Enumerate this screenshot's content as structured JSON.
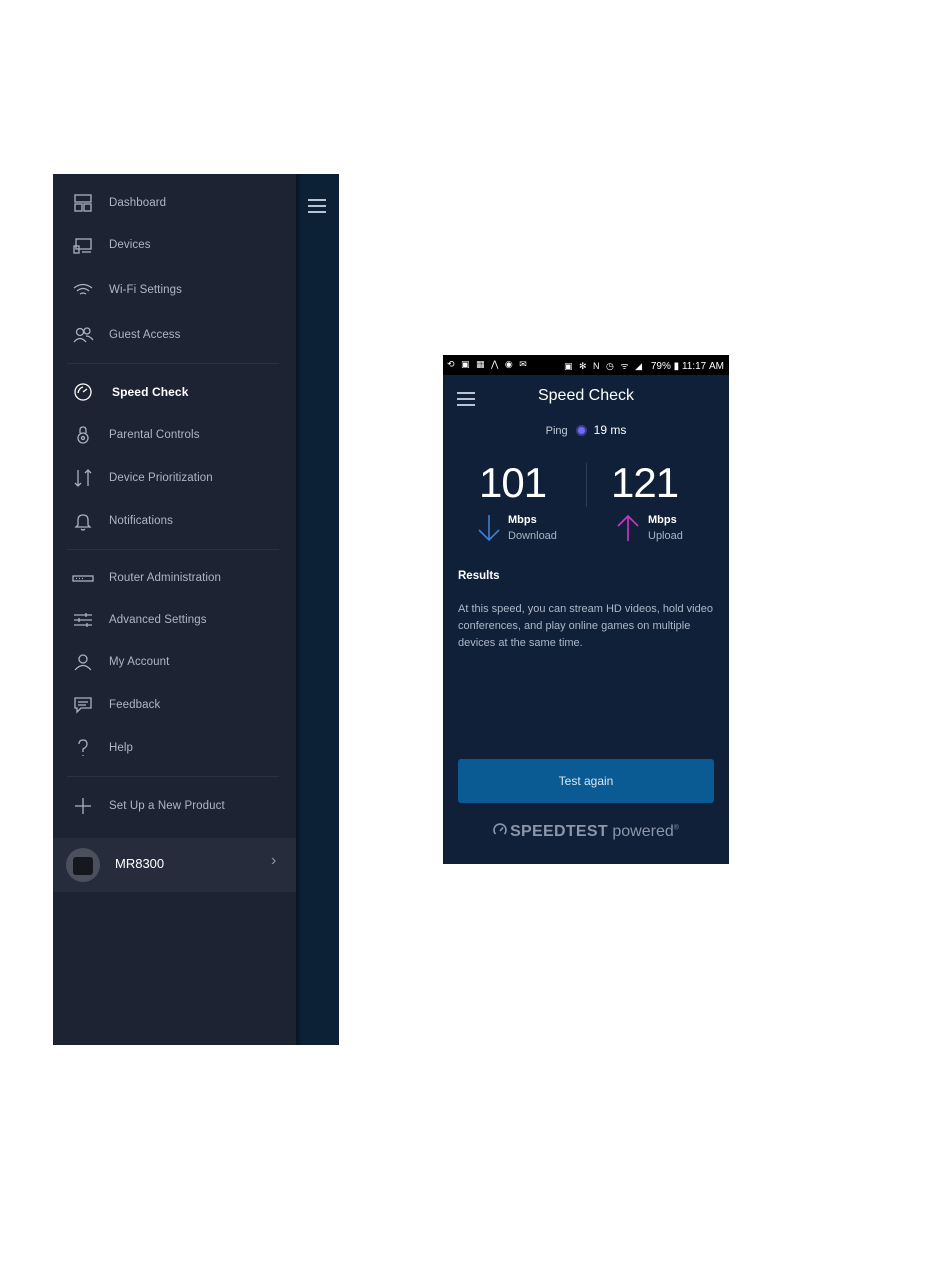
{
  "drawer": {
    "items": [
      {
        "label": "Dashboard",
        "icon": "dashboard-icon"
      },
      {
        "label": "Devices",
        "icon": "devices-icon"
      },
      {
        "label": "Wi-Fi Settings",
        "icon": "wifi-icon"
      },
      {
        "label": "Guest Access",
        "icon": "guest-access-icon"
      },
      {
        "label": "Speed Check",
        "icon": "speedometer-icon",
        "active": true
      },
      {
        "label": "Parental Controls",
        "icon": "lock-icon"
      },
      {
        "label": "Device Prioritization",
        "icon": "prioritization-arrows-icon"
      },
      {
        "label": "Notifications",
        "icon": "bell-icon"
      },
      {
        "label": "Router Administration",
        "icon": "router-icon"
      },
      {
        "label": "Advanced Settings",
        "icon": "sliders-icon"
      },
      {
        "label": "My Account",
        "icon": "user-icon"
      },
      {
        "label": "Feedback",
        "icon": "chat-icon"
      },
      {
        "label": "Help",
        "icon": "question-icon"
      },
      {
        "label": "Set Up a New Product",
        "icon": "plus-icon"
      }
    ],
    "device": {
      "name": "MR8300"
    }
  },
  "phone": {
    "status_bar": {
      "left_icons": "⟲ ▣ ▦ ⋀ ◉ ✉",
      "right_icons": "▣ ✻ N ◷ ᯤ ◢",
      "battery": "79%",
      "time": "11:17 AM"
    },
    "title": "Speed Check",
    "ping": {
      "label": "Ping",
      "value": "19 ms"
    },
    "download": {
      "value": "101",
      "unit": "Mbps",
      "label": "Download"
    },
    "upload": {
      "value": "121",
      "unit": "Mbps",
      "label": "Upload"
    },
    "results_heading": "Results",
    "results_text": "At this speed, you can stream HD videos, hold video conferences, and play online games on multiple devices at the same time.",
    "test_again_label": "Test again",
    "brand": {
      "speedtest": "SPEEDTEST",
      "powered": "powered"
    }
  },
  "colors": {
    "drawer_bg": "#1d2333",
    "phone_bg": "#0f2038",
    "download_arrow": "#3b7fd9",
    "upload_arrow": "#d236c9",
    "button": "#0a5a94"
  }
}
